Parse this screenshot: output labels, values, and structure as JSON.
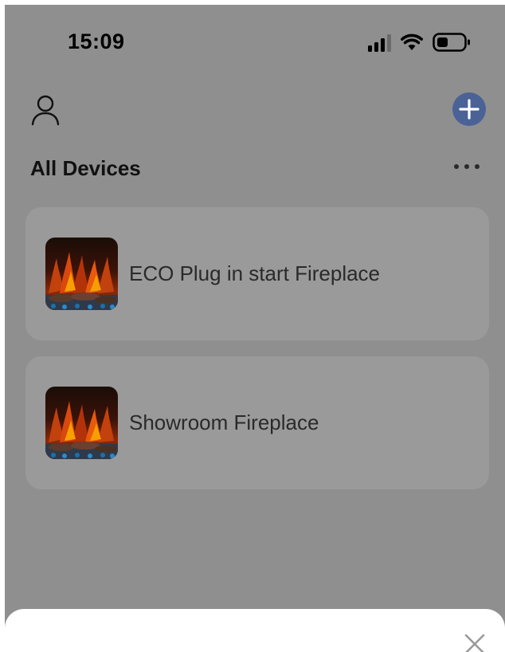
{
  "status_bar": {
    "time": "15:09",
    "signal": "cellular-signal-icon",
    "wifi": "wifi-icon",
    "battery": "battery-icon"
  },
  "header": {
    "profile_icon": "person-icon",
    "add_icon": "plus-icon"
  },
  "section": {
    "title": "All Devices",
    "more_icon": "more-horizontal-icon"
  },
  "devices": [
    {
      "name": "ECO Plug in start Fireplace",
      "thumbnail": "fireplace-thumbnail"
    },
    {
      "name": "Showroom Fireplace",
      "thumbnail": "fireplace-thumbnail"
    }
  ],
  "sheet": {
    "close_icon": "close-icon"
  },
  "colors": {
    "overlay_background": "#8f8f8f",
    "card_background": "#9a9a9a",
    "add_button": "#4a6296",
    "sheet_background": "#ffffff"
  }
}
